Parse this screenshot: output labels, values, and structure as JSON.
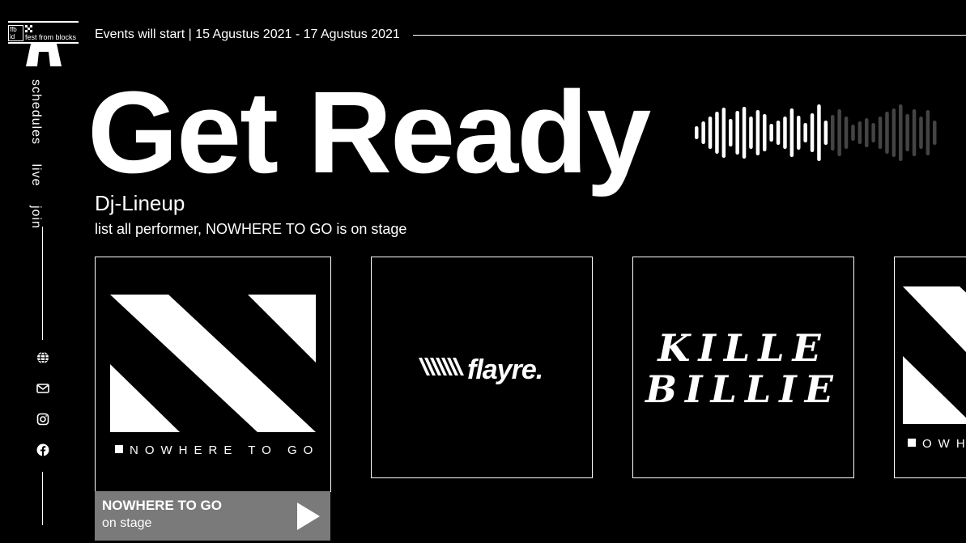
{
  "logo": {
    "box_text_1": "ffb",
    "box_text_2": "id",
    "name": "fest from blocks"
  },
  "nav": [
    {
      "label": "schedules"
    },
    {
      "label": "live"
    },
    {
      "label": "join"
    }
  ],
  "social": [
    "globe-icon",
    "mail-icon",
    "instagram-icon",
    "facebook-icon"
  ],
  "header": {
    "events_text": "Events will start  | 15 Agustus 2021 - 17 Agustus 2021"
  },
  "hero": {
    "title": "Get Ready"
  },
  "lineup": {
    "heading": "Dj-Lineup",
    "subtitle": "list all performer, NOWHERE TO GO is on stage",
    "cards": [
      {
        "brand": "NOWHERE TO GO",
        "caption_title": "NOWHERE TO GO",
        "caption_sub": "on stage"
      },
      {
        "brand": "flayre."
      },
      {
        "brand_line1": "KILLE",
        "brand_line2": "BILLIE"
      },
      {
        "brand": "OWH"
      }
    ]
  },
  "colors": {
    "background": "#000000",
    "foreground": "#ffffff",
    "caption": "#7a7a7a",
    "wave_dim": "#444444"
  }
}
